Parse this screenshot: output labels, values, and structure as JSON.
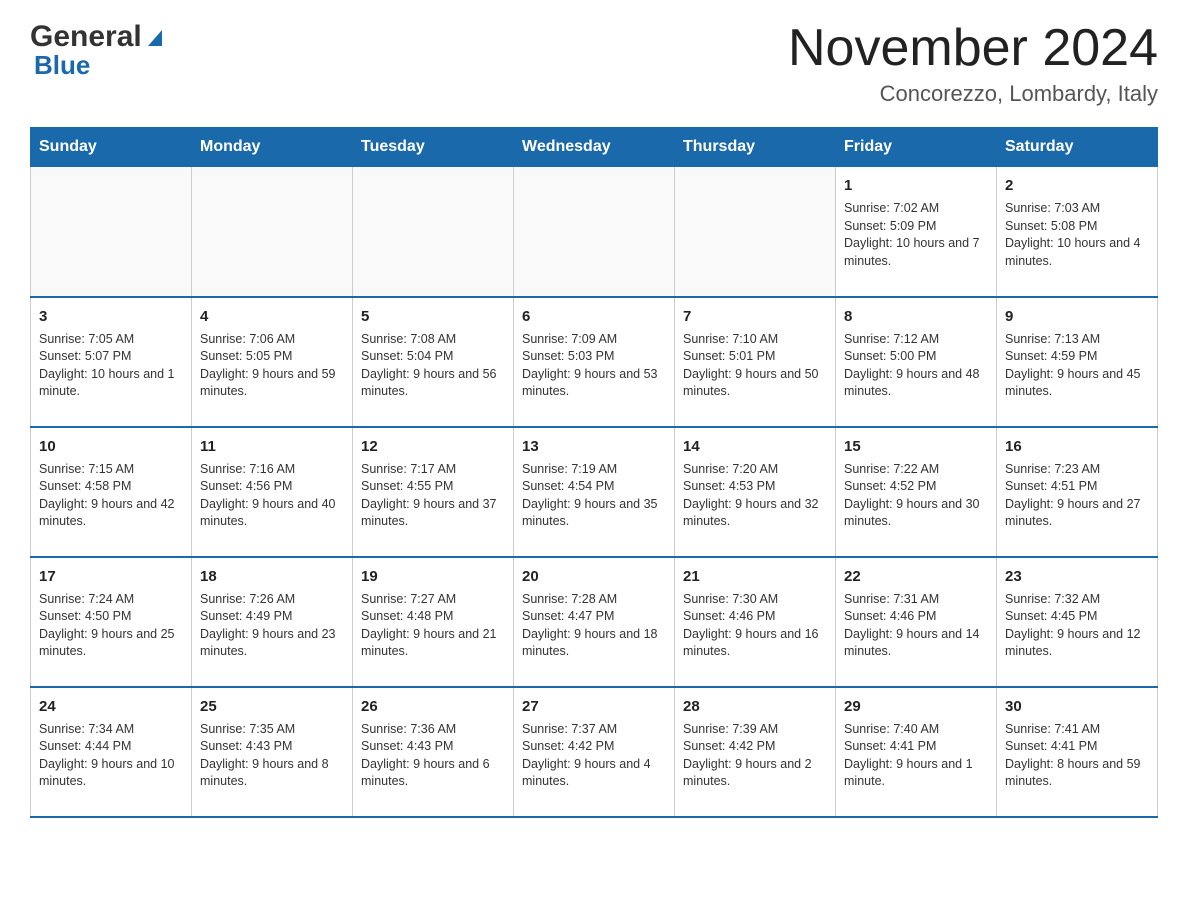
{
  "header": {
    "logo_general": "General",
    "logo_blue": "Blue",
    "month_title": "November 2024",
    "location": "Concorezzo, Lombardy, Italy"
  },
  "days_of_week": [
    "Sunday",
    "Monday",
    "Tuesday",
    "Wednesday",
    "Thursday",
    "Friday",
    "Saturday"
  ],
  "weeks": [
    [
      {
        "day": "",
        "info": ""
      },
      {
        "day": "",
        "info": ""
      },
      {
        "day": "",
        "info": ""
      },
      {
        "day": "",
        "info": ""
      },
      {
        "day": "",
        "info": ""
      },
      {
        "day": "1",
        "info": "Sunrise: 7:02 AM\nSunset: 5:09 PM\nDaylight: 10 hours and 7 minutes."
      },
      {
        "day": "2",
        "info": "Sunrise: 7:03 AM\nSunset: 5:08 PM\nDaylight: 10 hours and 4 minutes."
      }
    ],
    [
      {
        "day": "3",
        "info": "Sunrise: 7:05 AM\nSunset: 5:07 PM\nDaylight: 10 hours and 1 minute."
      },
      {
        "day": "4",
        "info": "Sunrise: 7:06 AM\nSunset: 5:05 PM\nDaylight: 9 hours and 59 minutes."
      },
      {
        "day": "5",
        "info": "Sunrise: 7:08 AM\nSunset: 5:04 PM\nDaylight: 9 hours and 56 minutes."
      },
      {
        "day": "6",
        "info": "Sunrise: 7:09 AM\nSunset: 5:03 PM\nDaylight: 9 hours and 53 minutes."
      },
      {
        "day": "7",
        "info": "Sunrise: 7:10 AM\nSunset: 5:01 PM\nDaylight: 9 hours and 50 minutes."
      },
      {
        "day": "8",
        "info": "Sunrise: 7:12 AM\nSunset: 5:00 PM\nDaylight: 9 hours and 48 minutes."
      },
      {
        "day": "9",
        "info": "Sunrise: 7:13 AM\nSunset: 4:59 PM\nDaylight: 9 hours and 45 minutes."
      }
    ],
    [
      {
        "day": "10",
        "info": "Sunrise: 7:15 AM\nSunset: 4:58 PM\nDaylight: 9 hours and 42 minutes."
      },
      {
        "day": "11",
        "info": "Sunrise: 7:16 AM\nSunset: 4:56 PM\nDaylight: 9 hours and 40 minutes."
      },
      {
        "day": "12",
        "info": "Sunrise: 7:17 AM\nSunset: 4:55 PM\nDaylight: 9 hours and 37 minutes."
      },
      {
        "day": "13",
        "info": "Sunrise: 7:19 AM\nSunset: 4:54 PM\nDaylight: 9 hours and 35 minutes."
      },
      {
        "day": "14",
        "info": "Sunrise: 7:20 AM\nSunset: 4:53 PM\nDaylight: 9 hours and 32 minutes."
      },
      {
        "day": "15",
        "info": "Sunrise: 7:22 AM\nSunset: 4:52 PM\nDaylight: 9 hours and 30 minutes."
      },
      {
        "day": "16",
        "info": "Sunrise: 7:23 AM\nSunset: 4:51 PM\nDaylight: 9 hours and 27 minutes."
      }
    ],
    [
      {
        "day": "17",
        "info": "Sunrise: 7:24 AM\nSunset: 4:50 PM\nDaylight: 9 hours and 25 minutes."
      },
      {
        "day": "18",
        "info": "Sunrise: 7:26 AM\nSunset: 4:49 PM\nDaylight: 9 hours and 23 minutes."
      },
      {
        "day": "19",
        "info": "Sunrise: 7:27 AM\nSunset: 4:48 PM\nDaylight: 9 hours and 21 minutes."
      },
      {
        "day": "20",
        "info": "Sunrise: 7:28 AM\nSunset: 4:47 PM\nDaylight: 9 hours and 18 minutes."
      },
      {
        "day": "21",
        "info": "Sunrise: 7:30 AM\nSunset: 4:46 PM\nDaylight: 9 hours and 16 minutes."
      },
      {
        "day": "22",
        "info": "Sunrise: 7:31 AM\nSunset: 4:46 PM\nDaylight: 9 hours and 14 minutes."
      },
      {
        "day": "23",
        "info": "Sunrise: 7:32 AM\nSunset: 4:45 PM\nDaylight: 9 hours and 12 minutes."
      }
    ],
    [
      {
        "day": "24",
        "info": "Sunrise: 7:34 AM\nSunset: 4:44 PM\nDaylight: 9 hours and 10 minutes."
      },
      {
        "day": "25",
        "info": "Sunrise: 7:35 AM\nSunset: 4:43 PM\nDaylight: 9 hours and 8 minutes."
      },
      {
        "day": "26",
        "info": "Sunrise: 7:36 AM\nSunset: 4:43 PM\nDaylight: 9 hours and 6 minutes."
      },
      {
        "day": "27",
        "info": "Sunrise: 7:37 AM\nSunset: 4:42 PM\nDaylight: 9 hours and 4 minutes."
      },
      {
        "day": "28",
        "info": "Sunrise: 7:39 AM\nSunset: 4:42 PM\nDaylight: 9 hours and 2 minutes."
      },
      {
        "day": "29",
        "info": "Sunrise: 7:40 AM\nSunset: 4:41 PM\nDaylight: 9 hours and 1 minute."
      },
      {
        "day": "30",
        "info": "Sunrise: 7:41 AM\nSunset: 4:41 PM\nDaylight: 8 hours and 59 minutes."
      }
    ]
  ]
}
